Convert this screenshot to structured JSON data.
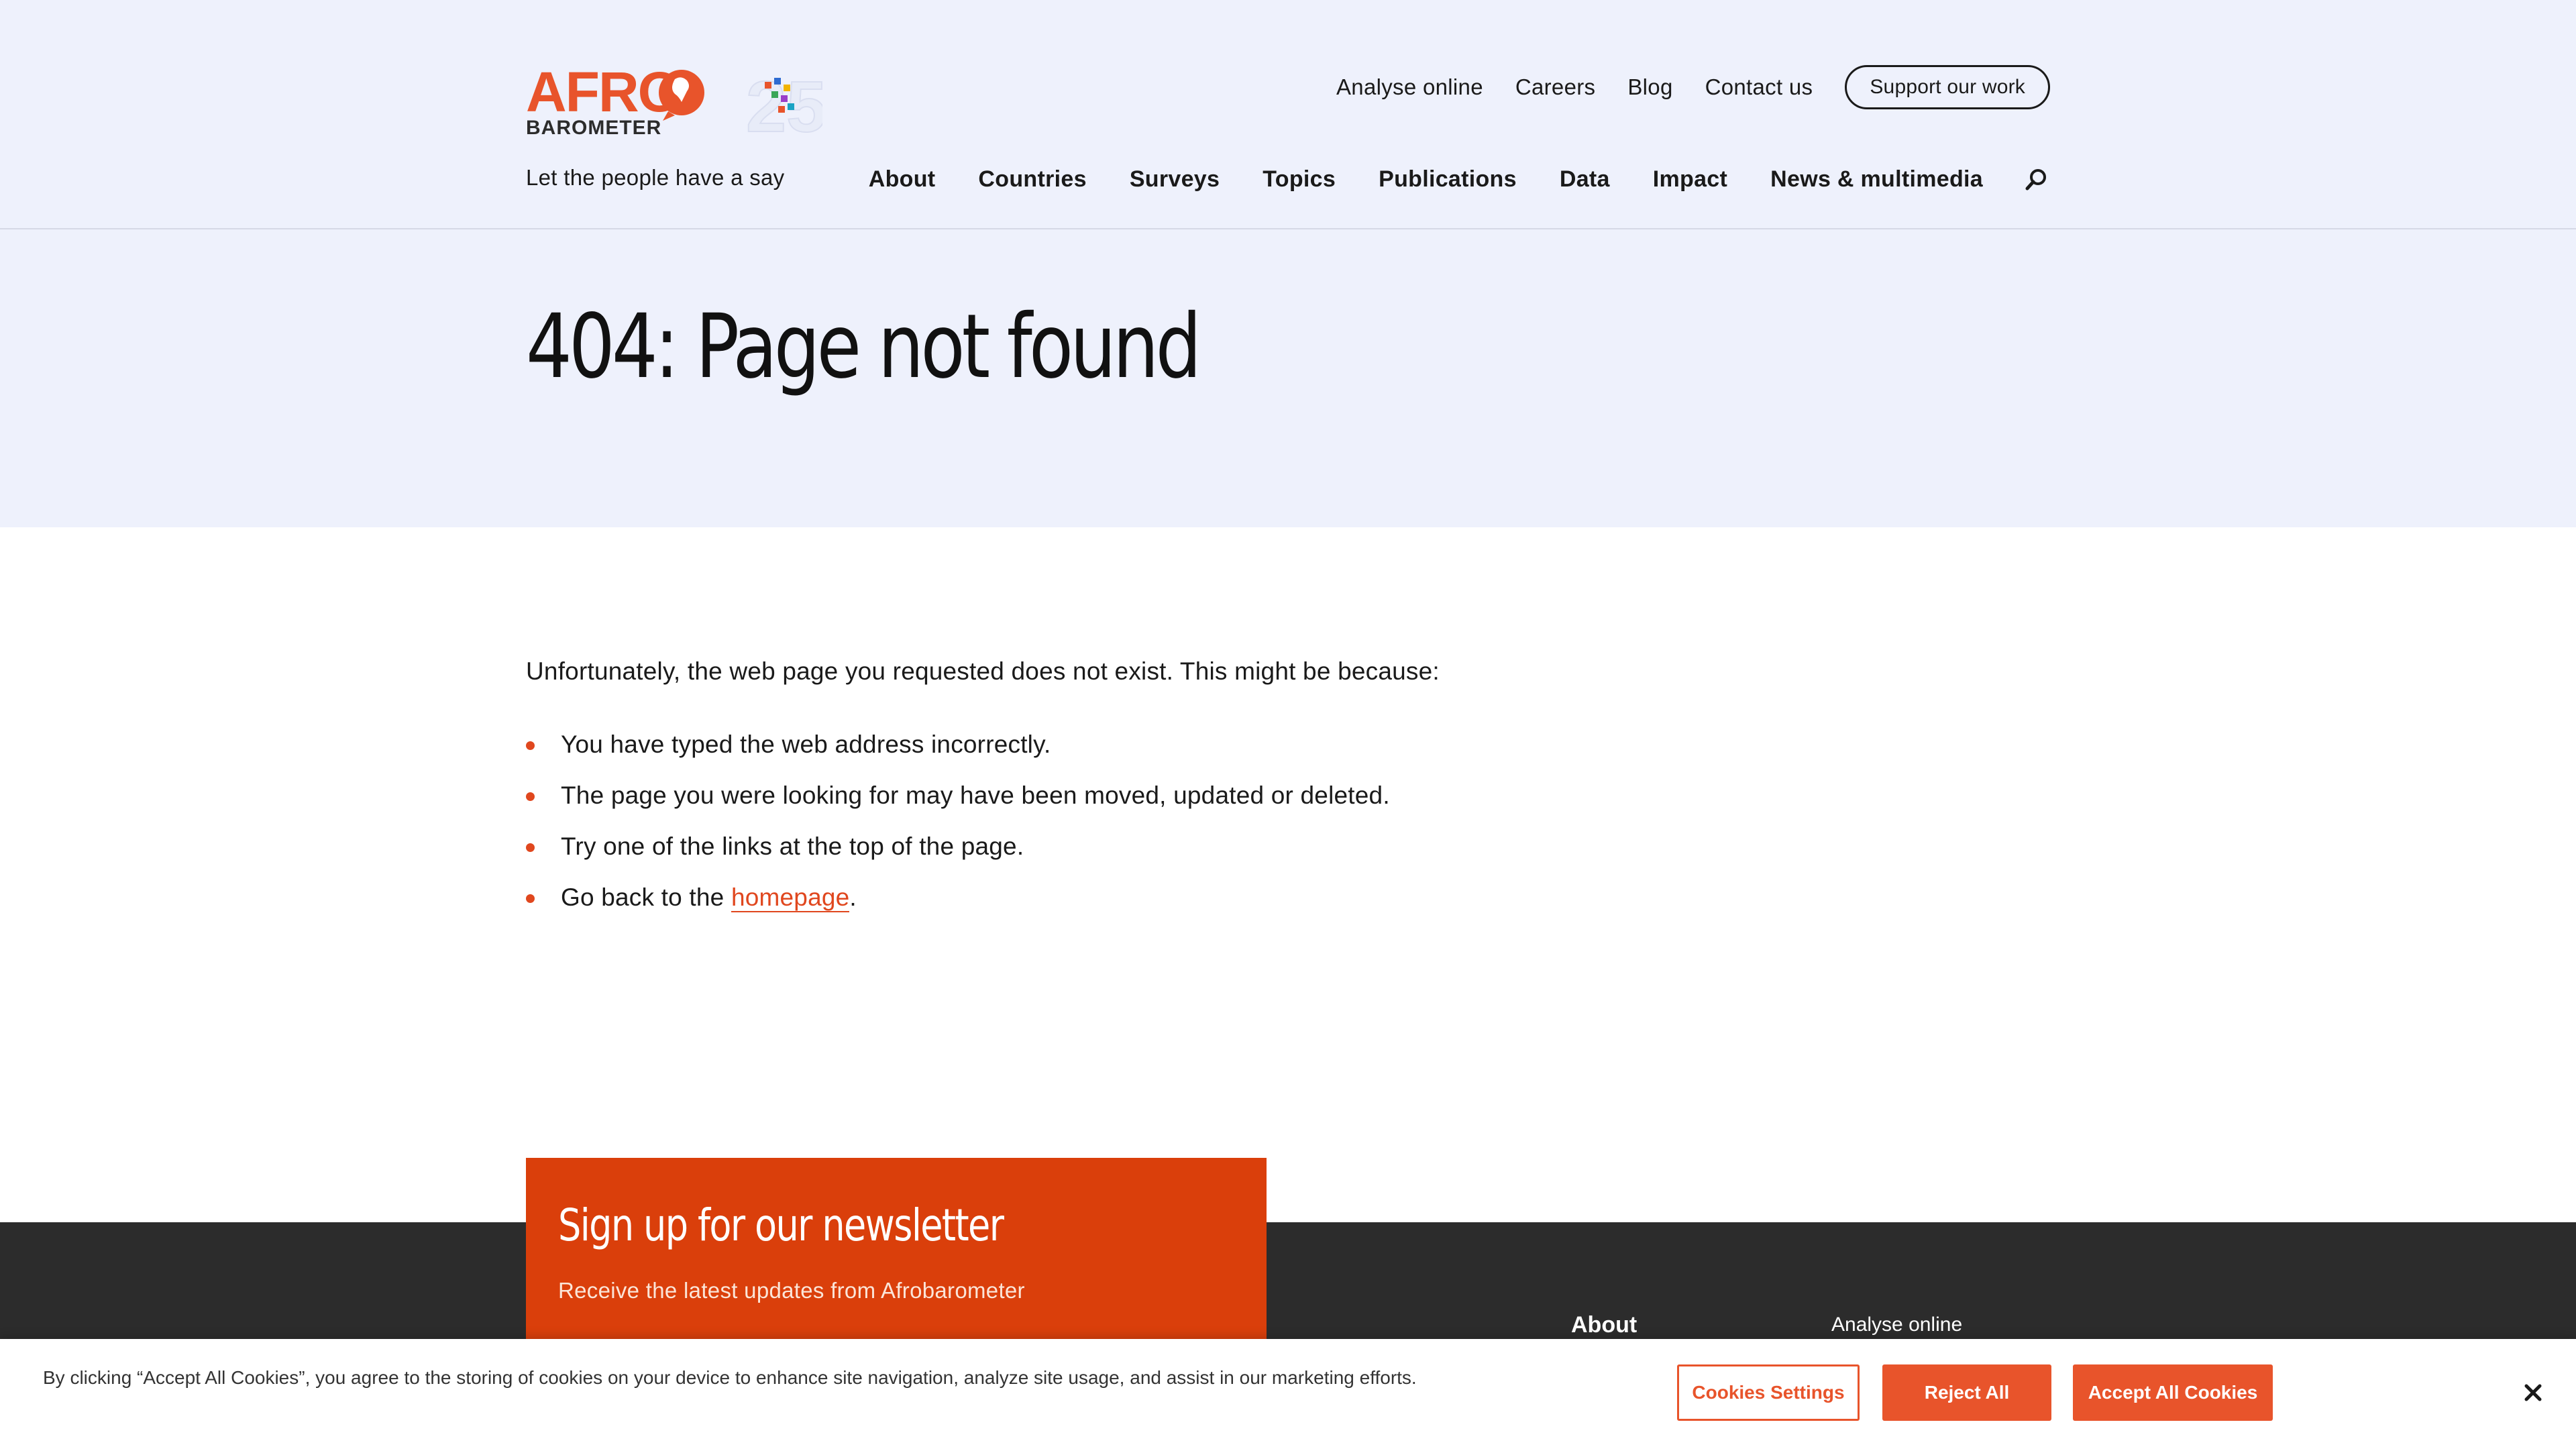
{
  "header": {
    "logo_text_top": "AFRO",
    "logo_text_bottom": "BAROMETER",
    "tagline": "Let the people have a say",
    "top_links": [
      "Analyse online",
      "Careers",
      "Blog",
      "Contact us"
    ],
    "support_button": "Support our work",
    "main_nav": [
      "About",
      "Countries",
      "Surveys",
      "Topics",
      "Publications",
      "Data",
      "Impact",
      "News & multimedia"
    ]
  },
  "hero": {
    "title": "404: Page not found"
  },
  "content": {
    "intro": "Unfortunately, the web page you requested does not exist. This might be because:",
    "reasons": [
      "You have typed the web address incorrectly.",
      "The page you were looking for may have been moved, updated or deleted.",
      "Try one of the links at the top of the page."
    ],
    "last_prefix": "Go back to the ",
    "last_link": "homepage",
    "last_suffix": "."
  },
  "newsletter": {
    "title": "Sign up for our newsletter",
    "subtitle": "Receive the latest updates from Afrobarometer"
  },
  "footer": {
    "about_heading": "About",
    "analyse_link": "Analyse online"
  },
  "cookie": {
    "text": "By clicking “Accept All Cookies”, you agree to the storing of cookies on your device to enhance site navigation, analyze site usage, and assist in our marketing efforts.",
    "settings": "Cookies Settings",
    "reject": "Reject All",
    "accept": "Accept All Cookies"
  },
  "colors": {
    "accent": "#e8542b",
    "header_bg": "#eef1fc",
    "footer_bg": "#2c2c2c",
    "newsletter_bg": "#da3f0b"
  }
}
